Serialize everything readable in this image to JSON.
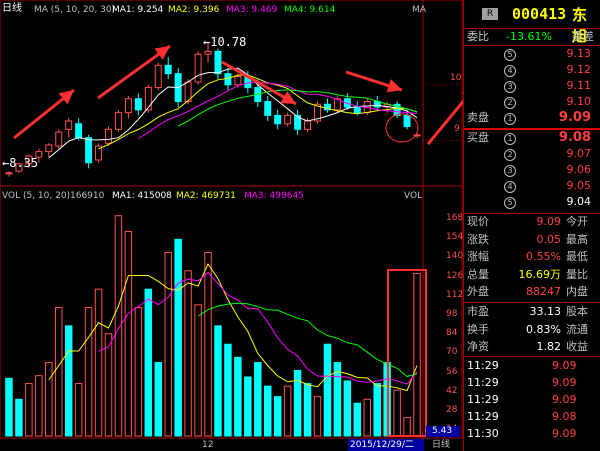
{
  "header": {
    "period": "日线",
    "ma_params": "MA (5, 10, 20, 30)",
    "ma1": "MA1: 9.254",
    "ma2": "MA2: 9.396",
    "ma3": "MA3: 9.469",
    "ma4": "MA4: 9.614",
    "mode_tag": "MA"
  },
  "price_axis": [
    "10",
    "9"
  ],
  "annotations": {
    "high": "←10.78",
    "low": "←8.35"
  },
  "volume_header": {
    "title": "VOL (5, 10, 20)",
    "vol": "166910",
    "ma1": "MA1: 415008",
    "ma2": "MA2: 469731",
    "ma3": "MA3: 499645",
    "tag": "VOL"
  },
  "volume_axis": [
    "168",
    "154",
    "140",
    "126",
    "112",
    "98",
    "84",
    "70",
    "56",
    "42",
    "28",
    "14"
  ],
  "volume_scale": "×10000",
  "date_axis": {
    "month": "12",
    "date": "2015/12/29/二",
    "period_tag": "日线",
    "readout": "5.43"
  },
  "colors": {
    "up": "#ff5050",
    "down": "#00ffff",
    "ma1": "#ffffff",
    "ma2": "#ffff00",
    "ma3": "#ff00ff",
    "ma4": "#00ff00",
    "arrow": "#ff3030"
  },
  "stock": {
    "badge": "R",
    "code": "000413",
    "name": "东旭"
  },
  "order_book": {
    "ratio_label": "委比",
    "ratio_value": "-13.61%",
    "diff_label": "委差",
    "sell_label": "卖盘",
    "buy_label": "买盘",
    "sells": [
      {
        "level": "5",
        "price": "9.13"
      },
      {
        "level": "4",
        "price": "9.12"
      },
      {
        "level": "3",
        "price": "9.11"
      },
      {
        "level": "2",
        "price": "9.10"
      },
      {
        "level": "1",
        "price": "9.09"
      }
    ],
    "buys": [
      {
        "level": "1",
        "price": "9.08"
      },
      {
        "level": "2",
        "price": "9.07"
      },
      {
        "level": "3",
        "price": "9.06"
      },
      {
        "level": "4",
        "price": "9.05"
      },
      {
        "level": "5",
        "price": "9.04"
      }
    ]
  },
  "quote": [
    {
      "l1": "现价",
      "v1": "9.09",
      "l2": "今开",
      "c": "#ff4040"
    },
    {
      "l1": "涨跌",
      "v1": "0.05",
      "l2": "最高",
      "c": "#ff4040"
    },
    {
      "l1": "涨幅",
      "v1": "0.55%",
      "l2": "最低",
      "c": "#ff4040"
    },
    {
      "l1": "总量",
      "v1": "16.69万",
      "l2": "量比",
      "c": "#ffff00"
    },
    {
      "l1": "外盘",
      "v1": "88247",
      "l2": "内盘",
      "c": "#ff4040"
    }
  ],
  "fundamentals": [
    {
      "l1": "市盈",
      "v1": "33.13",
      "l2": "股本"
    },
    {
      "l1": "换手",
      "v1": "0.83%",
      "l2": "流通"
    },
    {
      "l1": "净资",
      "v1": "1.82",
      "l2": "收益"
    }
  ],
  "ticks": [
    {
      "time": "11:29",
      "price": "9.09"
    },
    {
      "time": "11:29",
      "price": "9.09"
    },
    {
      "time": "11:29",
      "price": "9.09"
    },
    {
      "time": "11:29",
      "price": "9.08"
    },
    {
      "time": "11:30",
      "price": "9.09"
    }
  ],
  "chart_data": {
    "type": "candlestick+bar",
    "price_ylim": [
      8.2,
      11.2
    ],
    "volume_ylim": [
      0,
      180
    ],
    "candles": [
      {
        "o": 8.4,
        "h": 8.45,
        "l": 8.35,
        "c": 8.42,
        "up": true
      },
      {
        "o": 8.45,
        "h": 8.6,
        "l": 8.42,
        "c": 8.58,
        "up": true
      },
      {
        "o": 8.58,
        "h": 8.75,
        "l": 8.5,
        "c": 8.72,
        "up": true
      },
      {
        "o": 8.7,
        "h": 8.85,
        "l": 8.6,
        "c": 8.8,
        "up": true
      },
      {
        "o": 8.8,
        "h": 8.95,
        "l": 8.7,
        "c": 8.92,
        "up": true
      },
      {
        "o": 8.9,
        "h": 9.2,
        "l": 8.85,
        "c": 9.15,
        "up": true
      },
      {
        "o": 9.2,
        "h": 9.4,
        "l": 9.05,
        "c": 9.35,
        "up": true
      },
      {
        "o": 9.3,
        "h": 9.4,
        "l": 9.0,
        "c": 9.05,
        "up": false
      },
      {
        "o": 9.05,
        "h": 9.1,
        "l": 8.5,
        "c": 8.6,
        "up": false
      },
      {
        "o": 8.65,
        "h": 8.95,
        "l": 8.6,
        "c": 8.9,
        "up": true
      },
      {
        "o": 8.95,
        "h": 9.25,
        "l": 8.9,
        "c": 9.2,
        "up": true
      },
      {
        "o": 9.2,
        "h": 9.55,
        "l": 9.15,
        "c": 9.5,
        "up": true
      },
      {
        "o": 9.5,
        "h": 9.8,
        "l": 9.4,
        "c": 9.75,
        "up": true
      },
      {
        "o": 9.75,
        "h": 9.85,
        "l": 9.45,
        "c": 9.55,
        "up": false
      },
      {
        "o": 9.55,
        "h": 10.0,
        "l": 9.5,
        "c": 9.95,
        "up": true
      },
      {
        "o": 9.95,
        "h": 10.4,
        "l": 9.9,
        "c": 10.35,
        "up": true
      },
      {
        "o": 10.35,
        "h": 10.5,
        "l": 10.1,
        "c": 10.2,
        "up": false
      },
      {
        "o": 10.2,
        "h": 10.3,
        "l": 9.6,
        "c": 9.7,
        "up": false
      },
      {
        "o": 9.7,
        "h": 10.1,
        "l": 9.65,
        "c": 10.05,
        "up": true
      },
      {
        "o": 10.05,
        "h": 10.6,
        "l": 10.0,
        "c": 10.55,
        "up": true
      },
      {
        "o": 10.55,
        "h": 10.78,
        "l": 10.4,
        "c": 10.6,
        "up": true
      },
      {
        "o": 10.6,
        "h": 10.65,
        "l": 10.1,
        "c": 10.2,
        "up": false
      },
      {
        "o": 10.2,
        "h": 10.3,
        "l": 9.9,
        "c": 10.0,
        "up": false
      },
      {
        "o": 10.0,
        "h": 10.2,
        "l": 9.95,
        "c": 10.15,
        "up": true
      },
      {
        "o": 10.15,
        "h": 10.25,
        "l": 9.85,
        "c": 9.95,
        "up": false
      },
      {
        "o": 9.95,
        "h": 10.1,
        "l": 9.6,
        "c": 9.7,
        "up": false
      },
      {
        "o": 9.7,
        "h": 9.8,
        "l": 9.35,
        "c": 9.45,
        "up": false
      },
      {
        "o": 9.45,
        "h": 9.55,
        "l": 9.2,
        "c": 9.3,
        "up": false
      },
      {
        "o": 9.3,
        "h": 9.5,
        "l": 9.25,
        "c": 9.45,
        "up": true
      },
      {
        "o": 9.45,
        "h": 9.55,
        "l": 9.1,
        "c": 9.2,
        "up": false
      },
      {
        "o": 9.2,
        "h": 9.4,
        "l": 9.15,
        "c": 9.35,
        "up": true
      },
      {
        "o": 9.35,
        "h": 9.7,
        "l": 9.3,
        "c": 9.65,
        "up": true
      },
      {
        "o": 9.65,
        "h": 9.75,
        "l": 9.5,
        "c": 9.55,
        "up": false
      },
      {
        "o": 9.55,
        "h": 9.8,
        "l": 9.5,
        "c": 9.75,
        "up": true
      },
      {
        "o": 9.75,
        "h": 9.85,
        "l": 9.55,
        "c": 9.6,
        "up": false
      },
      {
        "o": 9.6,
        "h": 9.7,
        "l": 9.45,
        "c": 9.5,
        "up": false
      },
      {
        "o": 9.5,
        "h": 9.75,
        "l": 9.45,
        "c": 9.7,
        "up": true
      },
      {
        "o": 9.7,
        "h": 9.8,
        "l": 9.55,
        "c": 9.6,
        "up": false
      },
      {
        "o": 9.6,
        "h": 9.7,
        "l": 9.5,
        "c": 9.65,
        "up": true
      },
      {
        "o": 9.65,
        "h": 9.7,
        "l": 9.4,
        "c": 9.45,
        "up": false
      },
      {
        "o": 9.45,
        "h": 9.55,
        "l": 9.2,
        "c": 9.25,
        "up": false
      },
      {
        "o": 9.1,
        "h": 9.15,
        "l": 9.04,
        "c": 9.09,
        "up": true
      }
    ],
    "volumes": [
      {
        "v": 44,
        "up": false
      },
      {
        "v": 28,
        "up": false
      },
      {
        "v": 40,
        "up": true
      },
      {
        "v": 46,
        "up": true
      },
      {
        "v": 56,
        "up": true
      },
      {
        "v": 98,
        "up": true
      },
      {
        "v": 84,
        "up": false
      },
      {
        "v": 40,
        "up": true
      },
      {
        "v": 98,
        "up": true
      },
      {
        "v": 112,
        "up": true
      },
      {
        "v": 78,
        "up": true
      },
      {
        "v": 168,
        "up": true
      },
      {
        "v": 156,
        "up": true
      },
      {
        "v": 98,
        "up": true
      },
      {
        "v": 112,
        "up": false
      },
      {
        "v": 56,
        "up": false
      },
      {
        "v": 140,
        "up": true
      },
      {
        "v": 150,
        "up": false
      },
      {
        "v": 126,
        "up": true
      },
      {
        "v": 100,
        "up": true
      },
      {
        "v": 140,
        "up": true
      },
      {
        "v": 84,
        "up": false
      },
      {
        "v": 70,
        "up": false
      },
      {
        "v": 60,
        "up": false
      },
      {
        "v": 45,
        "up": false
      },
      {
        "v": 56,
        "up": false
      },
      {
        "v": 38,
        "up": false
      },
      {
        "v": 30,
        "up": false
      },
      {
        "v": 38,
        "up": true
      },
      {
        "v": 50,
        "up": false
      },
      {
        "v": 40,
        "up": false
      },
      {
        "v": 30,
        "up": true
      },
      {
        "v": 70,
        "up": false
      },
      {
        "v": 56,
        "up": false
      },
      {
        "v": 42,
        "up": false
      },
      {
        "v": 25,
        "up": false
      },
      {
        "v": 28,
        "up": true
      },
      {
        "v": 40,
        "up": false
      },
      {
        "v": 56,
        "up": false
      },
      {
        "v": 35,
        "up": true
      },
      {
        "v": 14,
        "up": true
      },
      {
        "v": 124,
        "up": true
      }
    ]
  }
}
